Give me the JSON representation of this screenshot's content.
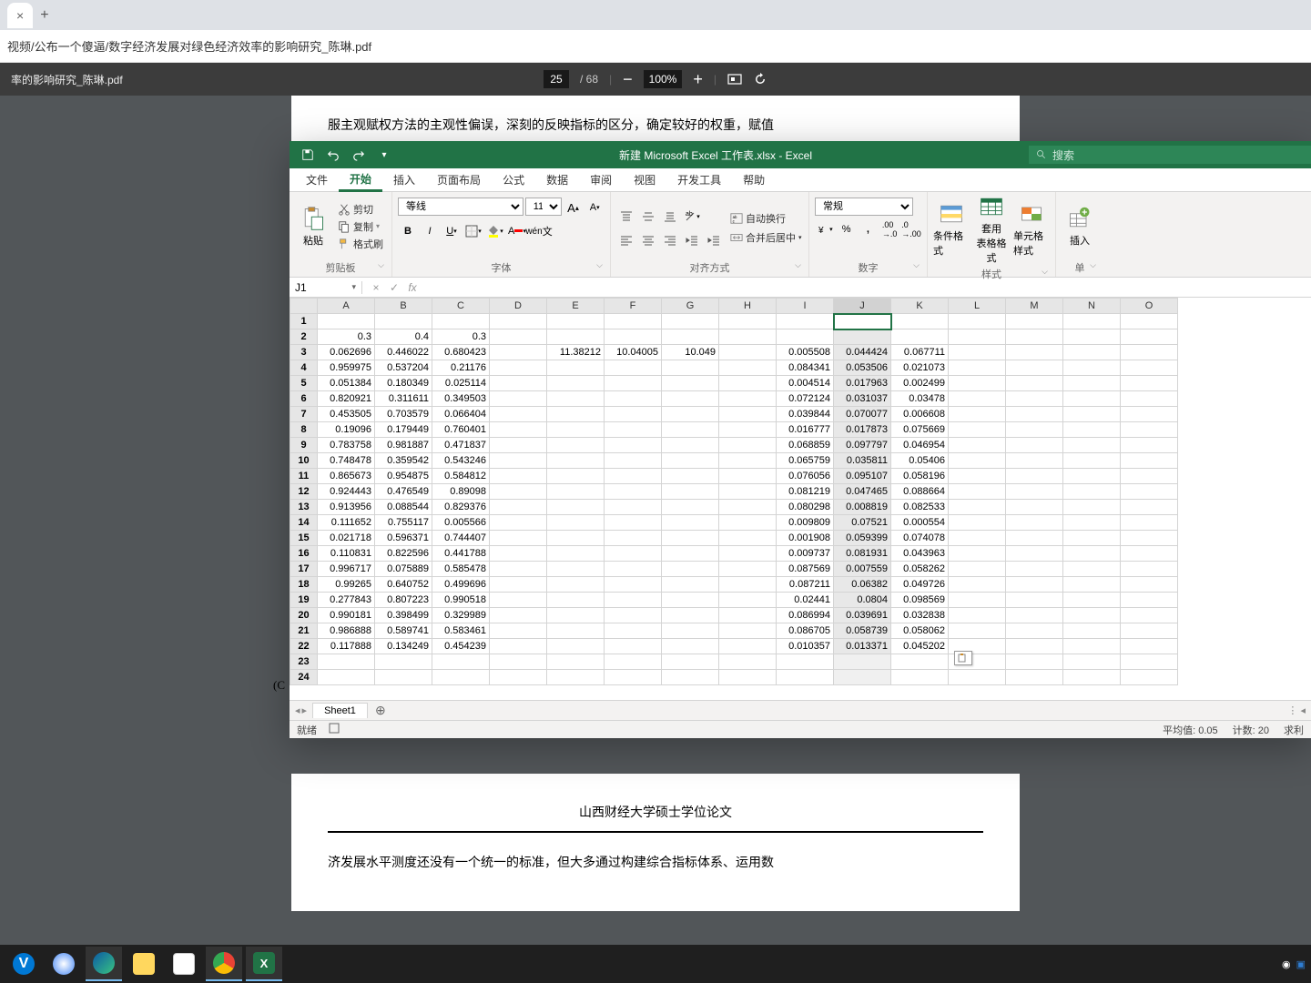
{
  "browser": {
    "address": "视频/公布一个傻逼/数字经济发展对绿色经济效率的影响研究_陈琳.pdf"
  },
  "pdf": {
    "filename": "率的影响研究_陈琳.pdf",
    "page_current": "25",
    "page_total": "/ 68",
    "zoom": "100%",
    "line_top": "服主观赋权方法的主观性偏误，深刻的反映指标的区分，确定较好的权重，赋值",
    "copyright": "(C",
    "page2_title": "山西财经大学硕士学位论文",
    "page2_line": "济发展水平测度还没有一个统一的标准，但大多通过构建综合指标体系、运用数"
  },
  "excel": {
    "title": "新建 Microsoft Excel 工作表.xlsx - Excel",
    "search_placeholder": "搜索",
    "tabs": [
      "文件",
      "开始",
      "插入",
      "页面布局",
      "公式",
      "数据",
      "审阅",
      "视图",
      "开发工具",
      "帮助"
    ],
    "active_tab": "开始",
    "ribbon": {
      "clipboard": {
        "paste": "粘贴",
        "cut": "剪切",
        "copy": "复制",
        "format_painter": "格式刷",
        "label": "剪贴板"
      },
      "font": {
        "name": "等线",
        "size": "11",
        "label": "字体"
      },
      "align": {
        "wrap": "自动换行",
        "merge": "合并后居中",
        "label": "对齐方式"
      },
      "number": {
        "format": "常规",
        "label": "数字"
      },
      "styles": {
        "cond": "条件格式",
        "table": "套用\n表格格式",
        "cell": "单元格样式",
        "label": "样式"
      },
      "cells": {
        "insert": "插入",
        "label": "单"
      }
    },
    "name_box": "J1",
    "columns": [
      "A",
      "B",
      "C",
      "D",
      "E",
      "F",
      "G",
      "H",
      "I",
      "J",
      "K",
      "L",
      "M",
      "N",
      "O"
    ],
    "rows": [
      {
        "n": 1,
        "c": {}
      },
      {
        "n": 2,
        "c": {
          "A": "0.3",
          "B": "0.4",
          "C": "0.3"
        }
      },
      {
        "n": 3,
        "c": {
          "A": "0.062696",
          "B": "0.446022",
          "C": "0.680423",
          "E": "11.38212",
          "F": "10.04005",
          "G": "10.049",
          "I": "0.005508",
          "J": "0.044424",
          "K": "0.067711"
        }
      },
      {
        "n": 4,
        "c": {
          "A": "0.959975",
          "B": "0.537204",
          "C": "0.21176",
          "I": "0.084341",
          "J": "0.053506",
          "K": "0.021073"
        }
      },
      {
        "n": 5,
        "c": {
          "A": "0.051384",
          "B": "0.180349",
          "C": "0.025114",
          "I": "0.004514",
          "J": "0.017963",
          "K": "0.002499"
        }
      },
      {
        "n": 6,
        "c": {
          "A": "0.820921",
          "B": "0.311611",
          "C": "0.349503",
          "I": "0.072124",
          "J": "0.031037",
          "K": "0.03478"
        }
      },
      {
        "n": 7,
        "c": {
          "A": "0.453505",
          "B": "0.703579",
          "C": "0.066404",
          "I": "0.039844",
          "J": "0.070077",
          "K": "0.006608"
        }
      },
      {
        "n": 8,
        "c": {
          "A": "0.19096",
          "B": "0.179449",
          "C": "0.760401",
          "I": "0.016777",
          "J": "0.017873",
          "K": "0.075669"
        }
      },
      {
        "n": 9,
        "c": {
          "A": "0.783758",
          "B": "0.981887",
          "C": "0.471837",
          "I": "0.068859",
          "J": "0.097797",
          "K": "0.046954"
        }
      },
      {
        "n": 10,
        "c": {
          "A": "0.748478",
          "B": "0.359542",
          "C": "0.543246",
          "I": "0.065759",
          "J": "0.035811",
          "K": "0.05406"
        }
      },
      {
        "n": 11,
        "c": {
          "A": "0.865673",
          "B": "0.954875",
          "C": "0.584812",
          "I": "0.076056",
          "J": "0.095107",
          "K": "0.058196"
        }
      },
      {
        "n": 12,
        "c": {
          "A": "0.924443",
          "B": "0.476549",
          "C": "0.89098",
          "I": "0.081219",
          "J": "0.047465",
          "K": "0.088664"
        }
      },
      {
        "n": 13,
        "c": {
          "A": "0.913956",
          "B": "0.088544",
          "C": "0.829376",
          "I": "0.080298",
          "J": "0.008819",
          "K": "0.082533"
        }
      },
      {
        "n": 14,
        "c": {
          "A": "0.111652",
          "B": "0.755117",
          "C": "0.005566",
          "I": "0.009809",
          "J": "0.07521",
          "K": "0.000554"
        }
      },
      {
        "n": 15,
        "c": {
          "A": "0.021718",
          "B": "0.596371",
          "C": "0.744407",
          "I": "0.001908",
          "J": "0.059399",
          "K": "0.074078"
        }
      },
      {
        "n": 16,
        "c": {
          "A": "0.110831",
          "B": "0.822596",
          "C": "0.441788",
          "I": "0.009737",
          "J": "0.081931",
          "K": "0.043963"
        }
      },
      {
        "n": 17,
        "c": {
          "A": "0.996717",
          "B": "0.075889",
          "C": "0.585478",
          "I": "0.087569",
          "J": "0.007559",
          "K": "0.058262"
        }
      },
      {
        "n": 18,
        "c": {
          "A": "0.99265",
          "B": "0.640752",
          "C": "0.499696",
          "I": "0.087211",
          "J": "0.06382",
          "K": "0.049726"
        }
      },
      {
        "n": 19,
        "c": {
          "A": "0.277843",
          "B": "0.807223",
          "C": "0.990518",
          "I": "0.02441",
          "J": "0.0804",
          "K": "0.098569"
        }
      },
      {
        "n": 20,
        "c": {
          "A": "0.990181",
          "B": "0.398499",
          "C": "0.329989",
          "I": "0.086994",
          "J": "0.039691",
          "K": "0.032838"
        }
      },
      {
        "n": 21,
        "c": {
          "A": "0.986888",
          "B": "0.589741",
          "C": "0.583461",
          "I": "0.086705",
          "J": "0.058739",
          "K": "0.058062"
        }
      },
      {
        "n": 22,
        "c": {
          "A": "0.117888",
          "B": "0.134249",
          "C": "0.454239",
          "I": "0.010357",
          "J": "0.013371",
          "K": "0.045202"
        }
      },
      {
        "n": 23,
        "c": {}
      },
      {
        "n": 24,
        "c": {}
      }
    ],
    "sheet_name": "Sheet1",
    "status_ready": "就绪",
    "status_avg": "平均值: 0.05",
    "status_count": "计数: 20",
    "status_sum": "求利"
  }
}
